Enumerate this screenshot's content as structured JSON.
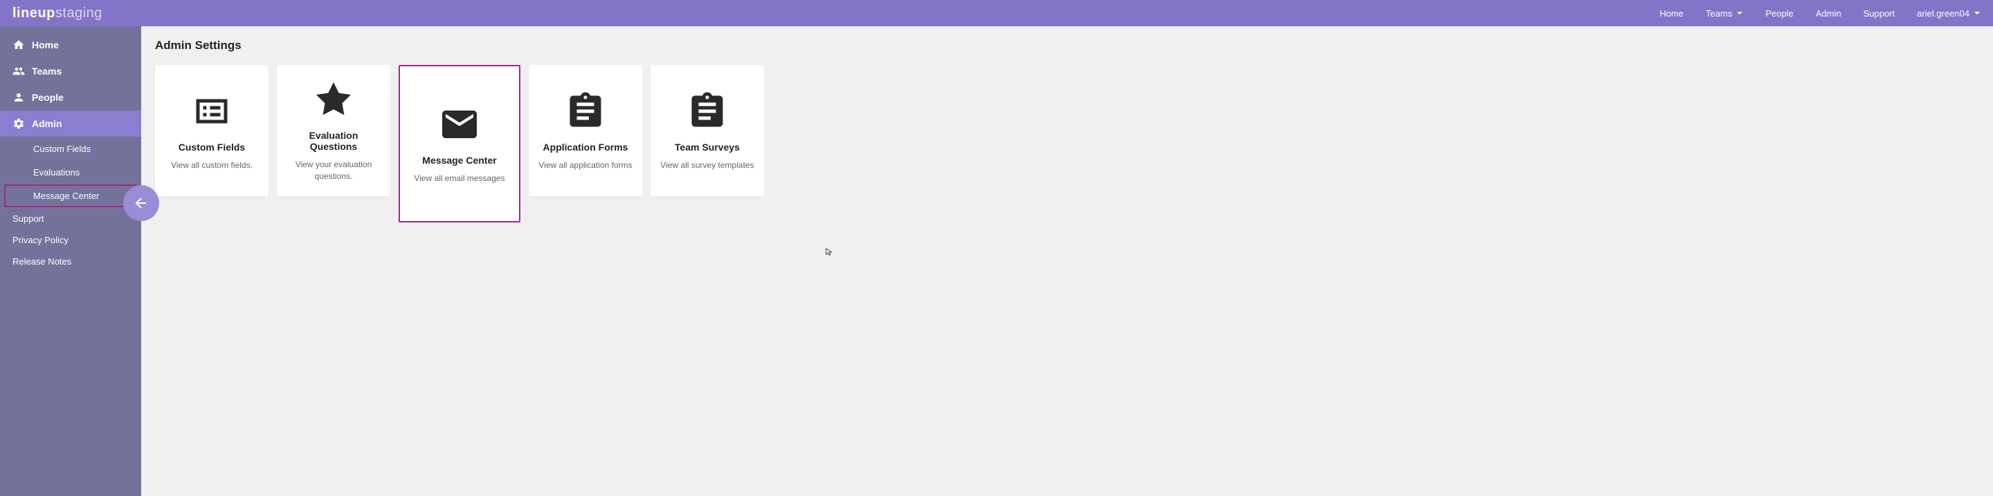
{
  "logo": {
    "part1": "lineup",
    "part2": "staging"
  },
  "topnav": {
    "home": "Home",
    "teams": "Teams",
    "people": "People",
    "admin": "Admin",
    "support": "Support",
    "user": "ariel.green04"
  },
  "sidebar": {
    "home": "Home",
    "teams": "Teams",
    "people": "People",
    "admin": "Admin",
    "sub_custom_fields": "Custom Fields",
    "sub_evaluations": "Evaluations",
    "sub_message_center": "Message Center",
    "support": "Support",
    "privacy": "Privacy Policy",
    "release": "Release Notes"
  },
  "main": {
    "title": "Admin Settings",
    "cards": {
      "custom_fields": {
        "title": "Custom Fields",
        "desc": "View all custom fields."
      },
      "evaluation_questions": {
        "title": "Evaluation Questions",
        "desc": "View your evaluation questions."
      },
      "message_center": {
        "title": "Message Center",
        "desc": "View all email messages"
      },
      "application_forms": {
        "title": "Application Forms",
        "desc": "View all application forms"
      },
      "team_surveys": {
        "title": "Team Surveys",
        "desc": "View all survey templates"
      }
    }
  }
}
